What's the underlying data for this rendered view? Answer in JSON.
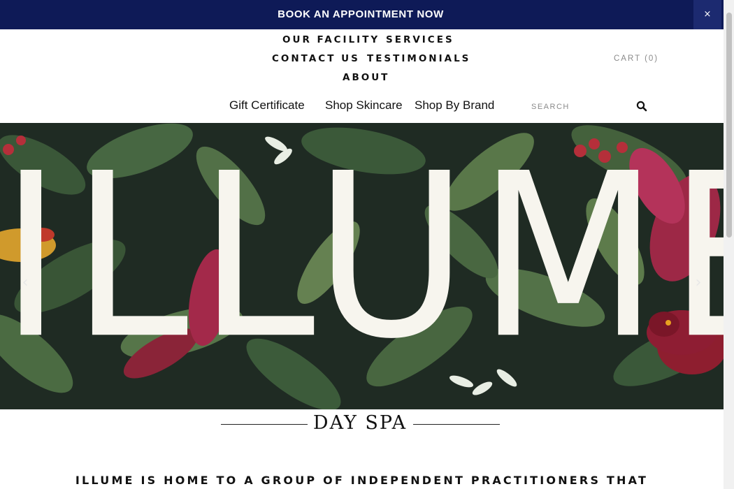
{
  "announcement": {
    "text": "BOOK AN APPOINTMENT NOW",
    "close": "×"
  },
  "nav": {
    "items": [
      "OUR FACILITY",
      "SERVICES",
      "CONTACT US",
      "TESTIMONIALS",
      "ABOUT"
    ],
    "cart": "CART (0)"
  },
  "shop_nav": {
    "items": [
      "Gift Certificate",
      "Shop Skincare",
      "Shop By Brand"
    ],
    "search_placeholder": "SEARCH",
    "search_icon": "search-icon"
  },
  "hero": {
    "title": "ILLUME",
    "prev_arrow": "‹",
    "next_arrow": "›"
  },
  "subtitle": "DAY SPA",
  "intro": "ILLUME IS HOME TO A GROUP OF INDEPENDENT PRACTITIONERS THAT WORK AS A TEAM IN NORTH EAST PORTLAND OREGON",
  "colors": {
    "banner": "#0e1a57",
    "text": "#111111",
    "cart": "#8a8a8a"
  }
}
